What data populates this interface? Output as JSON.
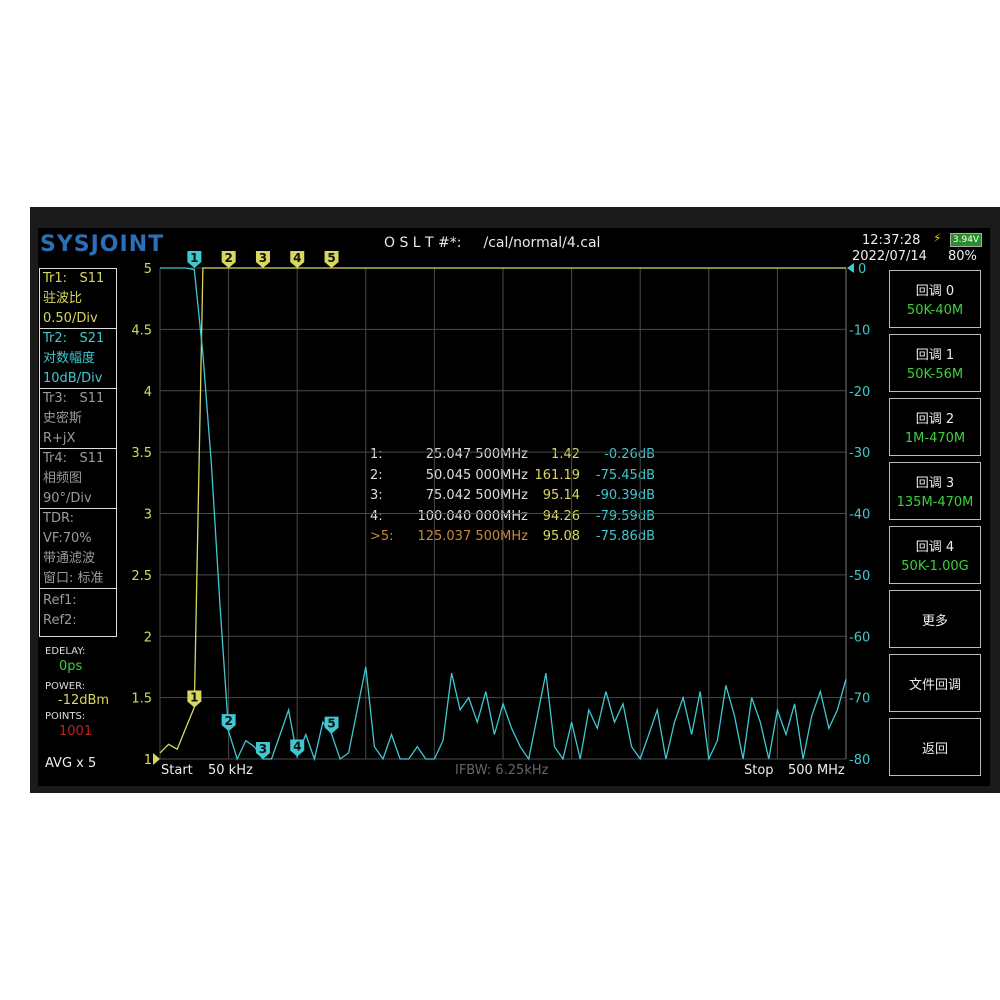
{
  "header": {
    "logo": "SYSJOINT",
    "cal_label": "O S L T #*:",
    "cal_path": "/cal/normal/4.cal",
    "time": "12:37:28",
    "date": "2022/07/14",
    "battery_voltage": "3.94V",
    "battery_percent": "80%"
  },
  "traces": [
    {
      "id": "Tr1:",
      "param": "S11",
      "format": "驻波比",
      "scale": "0.50/Div"
    },
    {
      "id": "Tr2:",
      "param": "S21",
      "format": "对数幅度",
      "scale": "10dB/Div"
    },
    {
      "id": "Tr3:",
      "param": "S11",
      "format": "史密斯",
      "scale": "R+jX"
    },
    {
      "id": "Tr4:",
      "param": "S11",
      "format": "相频图",
      "scale": "90°/Div"
    }
  ],
  "tdr": {
    "title": "TDR:",
    "vf": "VF:70%",
    "mode": "带通滤波",
    "window": "窗口: 标准"
  },
  "refs": {
    "ref1": "Ref1:",
    "ref2": "Ref2:"
  },
  "status": {
    "edelay_label": "EDELAY:",
    "edelay": "0ps",
    "power_label": "POWER:",
    "power": "-12dBm",
    "points_label": "POINTS:",
    "points": "1001",
    "avg": "AVG x 5"
  },
  "footer": {
    "start_label": "Start",
    "start": "50 kHz",
    "ifbw": "IFBW: 6.25kHz",
    "stop_label": "Stop",
    "stop": "500 MHz"
  },
  "buttons": [
    {
      "label": "回调 0",
      "sub": "50K-40M"
    },
    {
      "label": "回调 1",
      "sub": "50K-56M"
    },
    {
      "label": "回调 2",
      "sub": "1M-470M"
    },
    {
      "label": "回调 3",
      "sub": "135M-470M"
    },
    {
      "label": "回调 4",
      "sub": "50K-1.00G"
    },
    {
      "label": "更多"
    },
    {
      "label": "文件回调"
    },
    {
      "label": "返回"
    }
  ],
  "markers": [
    {
      "n": "1:",
      "freq": "25.047 500MHz",
      "swr": "1.42",
      "db": "-0.26dB"
    },
    {
      "n": "2:",
      "freq": "50.045 000MHz",
      "swr": "161.19",
      "db": "-75.45dB"
    },
    {
      "n": "3:",
      "freq": "75.042 500MHz",
      "swr": "95.14",
      "db": "-90.39dB"
    },
    {
      "n": "4:",
      "freq": "100.040 000MHz",
      "swr": "94.26",
      "db": "-79.59dB"
    },
    {
      "n": ">5:",
      "freq": "125.037 500MHz",
      "swr": "95.08",
      "db": "-75.86dB",
      "active": true
    }
  ],
  "chart_data": {
    "type": "line",
    "x_start_mhz": 0.05,
    "x_stop_mhz": 500,
    "x_step_mhz": 6.25,
    "left_axis": {
      "label": "VSWR",
      "range": [
        1,
        5
      ],
      "ticks": [
        "1",
        "1.5",
        "2",
        "2.5",
        "3",
        "3.5",
        "4",
        "4.5",
        "5"
      ]
    },
    "right_axis": {
      "label": "S21 dB",
      "range": [
        -80,
        0
      ],
      "ticks": [
        "0",
        "-10",
        "-20",
        "-30",
        "-40",
        "-50",
        "-60",
        "-70",
        "-80"
      ]
    },
    "series": [
      {
        "name": "Tr1 S11 VSWR",
        "color": "#d8d860",
        "axis": "left",
        "values": [
          1.05,
          1.12,
          1.08,
          1.25,
          1.42,
          5,
          5,
          5,
          5,
          5,
          5,
          5,
          5,
          5,
          5,
          5,
          5,
          5,
          5,
          5,
          5,
          5,
          5,
          5,
          5,
          5,
          5,
          5,
          5,
          5,
          5,
          5,
          5,
          5,
          5,
          5,
          5,
          5,
          5,
          5,
          5,
          5,
          5,
          5,
          5,
          5,
          5,
          5,
          5,
          5,
          5,
          5,
          5,
          5,
          5,
          5,
          5,
          5,
          5,
          5,
          5,
          5,
          5,
          5,
          5,
          5,
          5,
          5,
          5,
          5,
          5,
          5,
          5,
          5,
          5,
          5,
          5,
          5,
          5,
          5,
          5
        ]
      },
      {
        "name": "Tr2 S21 dB",
        "color": "#40c8d0",
        "axis": "right",
        "values": [
          0,
          0,
          0,
          0,
          -0.26,
          -14,
          -32,
          -55,
          -75.5,
          -80,
          -77,
          -78,
          -80,
          -80,
          -76,
          -72,
          -79.6,
          -76,
          -80,
          -74,
          -75.9,
          -80,
          -79,
          -72,
          -65,
          -78,
          -80,
          -76,
          -80,
          -80,
          -78,
          -80,
          -80,
          -77,
          -66,
          -72,
          -70,
          -74,
          -69,
          -76,
          -71,
          -75,
          -78,
          -80,
          -73,
          -66,
          -78,
          -80,
          -74,
          -80,
          -72,
          -75,
          -69,
          -74,
          -71,
          -78,
          -80,
          -76,
          -72,
          -80,
          -74,
          -70,
          -76,
          -69,
          -80,
          -77,
          -68,
          -73,
          -80,
          -70,
          -74,
          -80,
          -72,
          -76,
          -71,
          -80,
          -73,
          -69,
          -75,
          -72,
          -67
        ]
      }
    ],
    "marker_freqs_mhz": [
      25.0475,
      50.045,
      75.0425,
      100.04,
      125.0375
    ],
    "marker_labels": [
      "1",
      "2",
      "3",
      "4",
      "5"
    ]
  }
}
